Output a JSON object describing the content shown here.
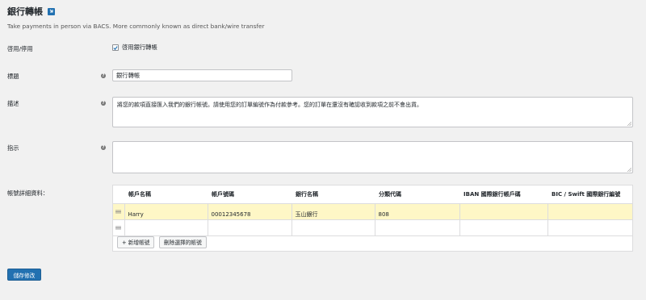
{
  "header": {
    "title": "銀行轉帳",
    "description": "Take payments in person via BACS. More commonly known as direct bank/wire transfer"
  },
  "fields": {
    "enable": {
      "label": "啓用/停用",
      "checkbox_label": "啓用銀行轉帳",
      "checked": true
    },
    "title": {
      "label": "標題",
      "value": "銀行轉帳"
    },
    "description": {
      "label": "描述",
      "value": "將您的款項直接匯入我們的銀行帳號。請使用您的訂單編號作為付款參考。您的訂單在還沒有確認收到款項之前不會出貨。"
    },
    "instructions": {
      "label": "指示",
      "value": ""
    },
    "account_details": {
      "label": "帳號詳細資料："
    }
  },
  "table": {
    "columns": [
      "帳戶名稱",
      "帳戶號碼",
      "銀行名稱",
      "分類代碼",
      "IBAN 國際銀行帳戶碼",
      "BIC / Swift 國際銀行編號"
    ],
    "rows": [
      [
        "Harry",
        "00012345678",
        "玉山銀行",
        "808",
        "",
        ""
      ],
      [
        "",
        "",
        "",
        "",
        "",
        ""
      ]
    ]
  },
  "buttons": {
    "add_account": "+ 新增帳號",
    "remove_selected": "刪除選擇的帳號",
    "save": "儲存修改"
  },
  "colors": {
    "primary": "#2271b1",
    "selected_row": "#fef7c6",
    "background": "#f1f1f1"
  }
}
